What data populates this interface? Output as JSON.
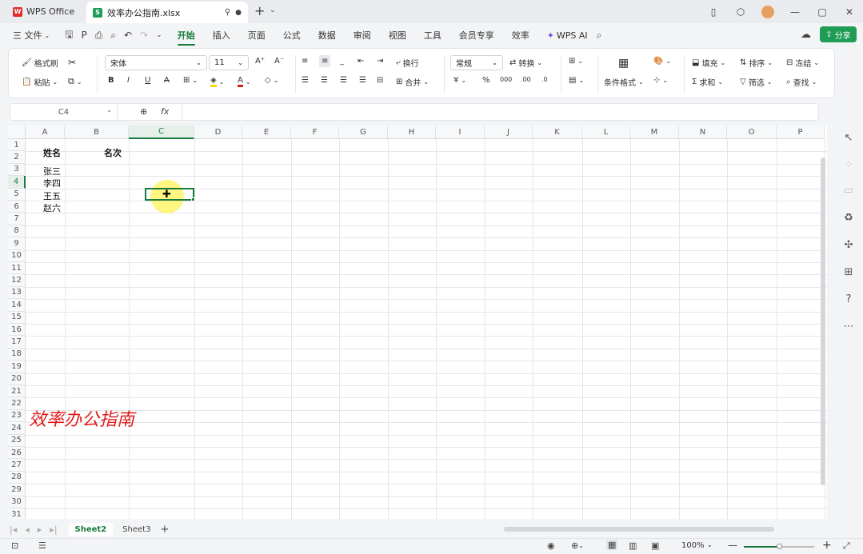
{
  "titlebar": {
    "app_tab": "WPS Office",
    "doc_tab": "效率办公指南.xlsx",
    "new_tab": "+"
  },
  "menu": {
    "file": "三 文件",
    "items": [
      "开始",
      "插入",
      "页面",
      "公式",
      "数据",
      "审阅",
      "视图",
      "工具",
      "会员专享",
      "效率"
    ],
    "active": "开始",
    "wps_ai": "WPS AI",
    "share": "分享"
  },
  "ribbon": {
    "format_painter": "格式刷",
    "paste": "粘贴",
    "font_name": "宋体",
    "font_size": "11",
    "wrap": "换行",
    "merge": "合并",
    "number_format": "常规",
    "convert": "转换",
    "cond_format": "条件格式",
    "fill": "填充",
    "sort": "排序",
    "freeze": "冻结",
    "sum": "求和",
    "filter": "筛选",
    "find": "查找",
    "currency": "¥",
    "percent": "%"
  },
  "formula": {
    "name_box": "C4",
    "fx": "fx",
    "value": ""
  },
  "grid": {
    "columns": [
      "A",
      "B",
      "C",
      "D",
      "E",
      "F",
      "G",
      "H",
      "I",
      "J",
      "K",
      "L",
      "M",
      "N",
      "O",
      "P"
    ],
    "rows": [
      "1",
      "2",
      "3",
      "4",
      "5",
      "6",
      "7",
      "8",
      "9",
      "10",
      "11",
      "12",
      "13",
      "14",
      "15",
      "16",
      "17",
      "18",
      "19",
      "20",
      "21",
      "22",
      "23",
      "24",
      "25",
      "26",
      "27",
      "28",
      "29",
      "30",
      "31"
    ],
    "cells": {
      "A1": "姓名",
      "B1": "名次",
      "A2": "张三",
      "A3": "李四",
      "A4": "王五",
      "A5": "赵六"
    },
    "selected": "C4",
    "watermark": "效率办公指南"
  },
  "sheets": {
    "tabs": [
      "Sheet2",
      "Sheet3"
    ],
    "active": "Sheet2",
    "add": "+"
  },
  "status": {
    "zoom": "100%"
  },
  "colors": {
    "accent": "#1a7a3e",
    "share": "#1f9d55",
    "watermark": "#e01b1b",
    "selection": "#1a7a3e",
    "cursor_highlight": "#fff36b"
  }
}
